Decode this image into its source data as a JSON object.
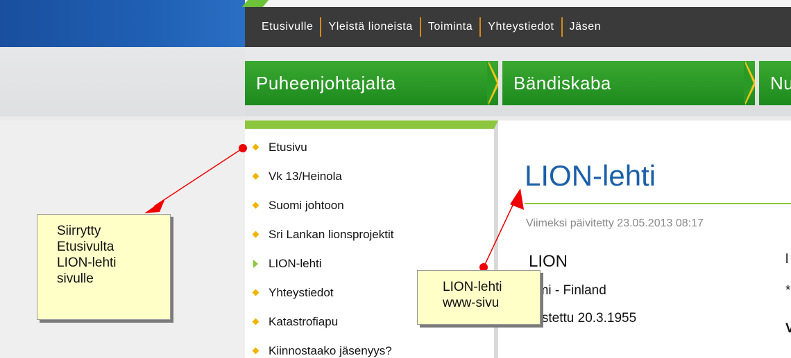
{
  "topnav": {
    "items": [
      "Etusivulle",
      "Yleistä lioneista",
      "Toiminta",
      "Yhteystiedot",
      "Jäsen"
    ]
  },
  "green_tabs": [
    "Puheenjohtajalta",
    "Bändiskaba",
    "Nu"
  ],
  "sidebar": {
    "items": [
      {
        "label": "Etusivu",
        "marker": "diamond"
      },
      {
        "label": "Vk 13/Heinola",
        "marker": "diamond"
      },
      {
        "label": "Suomi johtoon",
        "marker": "diamond"
      },
      {
        "label": "Sri Lankan lionsprojektit",
        "marker": "diamond"
      },
      {
        "label": "LION-lehti",
        "marker": "triangle"
      },
      {
        "label": "Yhteystiedot",
        "marker": "diamond"
      },
      {
        "label": "Katastrofiapu",
        "marker": "diamond"
      },
      {
        "label": "Kiinnostaako jäsenyys?",
        "marker": "diamond"
      }
    ]
  },
  "content": {
    "title": "LION-lehti",
    "updated": "Viimeksi päivitetty 23.05.2013 08:17",
    "lion": "LION",
    "country": "omi - Finland",
    "founded": "rustettu 20.3.1955",
    "right_fragments": [
      "l",
      "*",
      "V"
    ]
  },
  "annotations": {
    "note1": [
      "Siirrytty",
      "Etusivulta",
      "LION-lehti",
      "sivulle"
    ],
    "note2": [
      "LION-lehti",
      "www-sivu"
    ]
  },
  "colors": {
    "accent_green": "#8cc63f",
    "title_blue": "#1a5fa8",
    "bullet": "#f0b400",
    "annotation_red": "#e00000"
  }
}
